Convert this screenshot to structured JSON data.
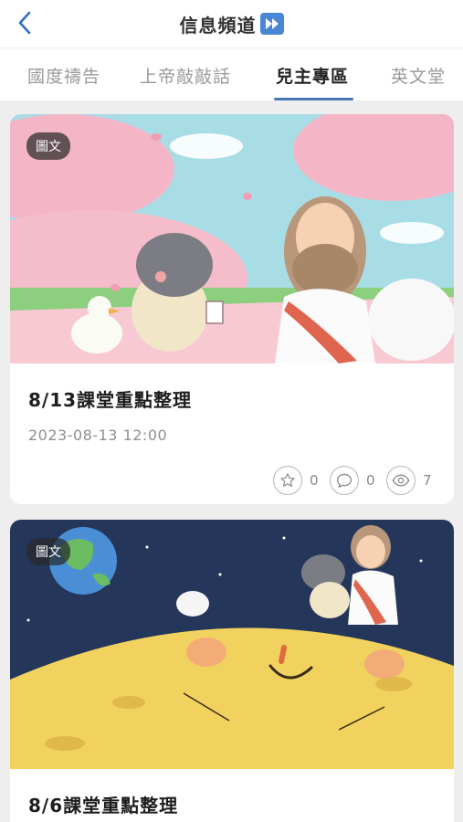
{
  "header": {
    "title": "信息頻道",
    "back_icon": "chevron-left-icon",
    "title_icon": "fast-forward-icon",
    "accent": "#2f6fc7"
  },
  "tabs": [
    {
      "label": "國度禱告",
      "active": false
    },
    {
      "label": "上帝敲敲話",
      "active": false
    },
    {
      "label": "兒主專區",
      "active": true
    },
    {
      "label": "英文堂",
      "active": false
    }
  ],
  "posts": [
    {
      "badge": "圖文",
      "title": "8/13課堂重點整理",
      "date": "2023-08-13 12:00",
      "stats": {
        "likes": "0",
        "comments": "0",
        "views": "7"
      }
    },
    {
      "badge": "圖文",
      "title": "8/6課堂重點整理"
    }
  ]
}
